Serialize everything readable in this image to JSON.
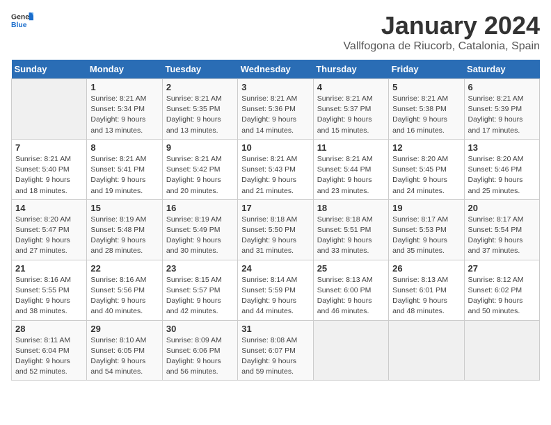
{
  "header": {
    "logo_general": "General",
    "logo_blue": "Blue",
    "title": "January 2024",
    "subtitle": "Vallfogona de Riucorb, Catalonia, Spain"
  },
  "calendar": {
    "days_of_week": [
      "Sunday",
      "Monday",
      "Tuesday",
      "Wednesday",
      "Thursday",
      "Friday",
      "Saturday"
    ],
    "weeks": [
      [
        {
          "num": "",
          "info": ""
        },
        {
          "num": "1",
          "info": "Sunrise: 8:21 AM\nSunset: 5:34 PM\nDaylight: 9 hours\nand 13 minutes."
        },
        {
          "num": "2",
          "info": "Sunrise: 8:21 AM\nSunset: 5:35 PM\nDaylight: 9 hours\nand 13 minutes."
        },
        {
          "num": "3",
          "info": "Sunrise: 8:21 AM\nSunset: 5:36 PM\nDaylight: 9 hours\nand 14 minutes."
        },
        {
          "num": "4",
          "info": "Sunrise: 8:21 AM\nSunset: 5:37 PM\nDaylight: 9 hours\nand 15 minutes."
        },
        {
          "num": "5",
          "info": "Sunrise: 8:21 AM\nSunset: 5:38 PM\nDaylight: 9 hours\nand 16 minutes."
        },
        {
          "num": "6",
          "info": "Sunrise: 8:21 AM\nSunset: 5:39 PM\nDaylight: 9 hours\nand 17 minutes."
        }
      ],
      [
        {
          "num": "7",
          "info": "Sunrise: 8:21 AM\nSunset: 5:40 PM\nDaylight: 9 hours\nand 18 minutes."
        },
        {
          "num": "8",
          "info": "Sunrise: 8:21 AM\nSunset: 5:41 PM\nDaylight: 9 hours\nand 19 minutes."
        },
        {
          "num": "9",
          "info": "Sunrise: 8:21 AM\nSunset: 5:42 PM\nDaylight: 9 hours\nand 20 minutes."
        },
        {
          "num": "10",
          "info": "Sunrise: 8:21 AM\nSunset: 5:43 PM\nDaylight: 9 hours\nand 21 minutes."
        },
        {
          "num": "11",
          "info": "Sunrise: 8:21 AM\nSunset: 5:44 PM\nDaylight: 9 hours\nand 23 minutes."
        },
        {
          "num": "12",
          "info": "Sunrise: 8:20 AM\nSunset: 5:45 PM\nDaylight: 9 hours\nand 24 minutes."
        },
        {
          "num": "13",
          "info": "Sunrise: 8:20 AM\nSunset: 5:46 PM\nDaylight: 9 hours\nand 25 minutes."
        }
      ],
      [
        {
          "num": "14",
          "info": "Sunrise: 8:20 AM\nSunset: 5:47 PM\nDaylight: 9 hours\nand 27 minutes."
        },
        {
          "num": "15",
          "info": "Sunrise: 8:19 AM\nSunset: 5:48 PM\nDaylight: 9 hours\nand 28 minutes."
        },
        {
          "num": "16",
          "info": "Sunrise: 8:19 AM\nSunset: 5:49 PM\nDaylight: 9 hours\nand 30 minutes."
        },
        {
          "num": "17",
          "info": "Sunrise: 8:18 AM\nSunset: 5:50 PM\nDaylight: 9 hours\nand 31 minutes."
        },
        {
          "num": "18",
          "info": "Sunrise: 8:18 AM\nSunset: 5:51 PM\nDaylight: 9 hours\nand 33 minutes."
        },
        {
          "num": "19",
          "info": "Sunrise: 8:17 AM\nSunset: 5:53 PM\nDaylight: 9 hours\nand 35 minutes."
        },
        {
          "num": "20",
          "info": "Sunrise: 8:17 AM\nSunset: 5:54 PM\nDaylight: 9 hours\nand 37 minutes."
        }
      ],
      [
        {
          "num": "21",
          "info": "Sunrise: 8:16 AM\nSunset: 5:55 PM\nDaylight: 9 hours\nand 38 minutes."
        },
        {
          "num": "22",
          "info": "Sunrise: 8:16 AM\nSunset: 5:56 PM\nDaylight: 9 hours\nand 40 minutes."
        },
        {
          "num": "23",
          "info": "Sunrise: 8:15 AM\nSunset: 5:57 PM\nDaylight: 9 hours\nand 42 minutes."
        },
        {
          "num": "24",
          "info": "Sunrise: 8:14 AM\nSunset: 5:59 PM\nDaylight: 9 hours\nand 44 minutes."
        },
        {
          "num": "25",
          "info": "Sunrise: 8:13 AM\nSunset: 6:00 PM\nDaylight: 9 hours\nand 46 minutes."
        },
        {
          "num": "26",
          "info": "Sunrise: 8:13 AM\nSunset: 6:01 PM\nDaylight: 9 hours\nand 48 minutes."
        },
        {
          "num": "27",
          "info": "Sunrise: 8:12 AM\nSunset: 6:02 PM\nDaylight: 9 hours\nand 50 minutes."
        }
      ],
      [
        {
          "num": "28",
          "info": "Sunrise: 8:11 AM\nSunset: 6:04 PM\nDaylight: 9 hours\nand 52 minutes."
        },
        {
          "num": "29",
          "info": "Sunrise: 8:10 AM\nSunset: 6:05 PM\nDaylight: 9 hours\nand 54 minutes."
        },
        {
          "num": "30",
          "info": "Sunrise: 8:09 AM\nSunset: 6:06 PM\nDaylight: 9 hours\nand 56 minutes."
        },
        {
          "num": "31",
          "info": "Sunrise: 8:08 AM\nSunset: 6:07 PM\nDaylight: 9 hours\nand 59 minutes."
        },
        {
          "num": "",
          "info": ""
        },
        {
          "num": "",
          "info": ""
        },
        {
          "num": "",
          "info": ""
        }
      ]
    ]
  }
}
